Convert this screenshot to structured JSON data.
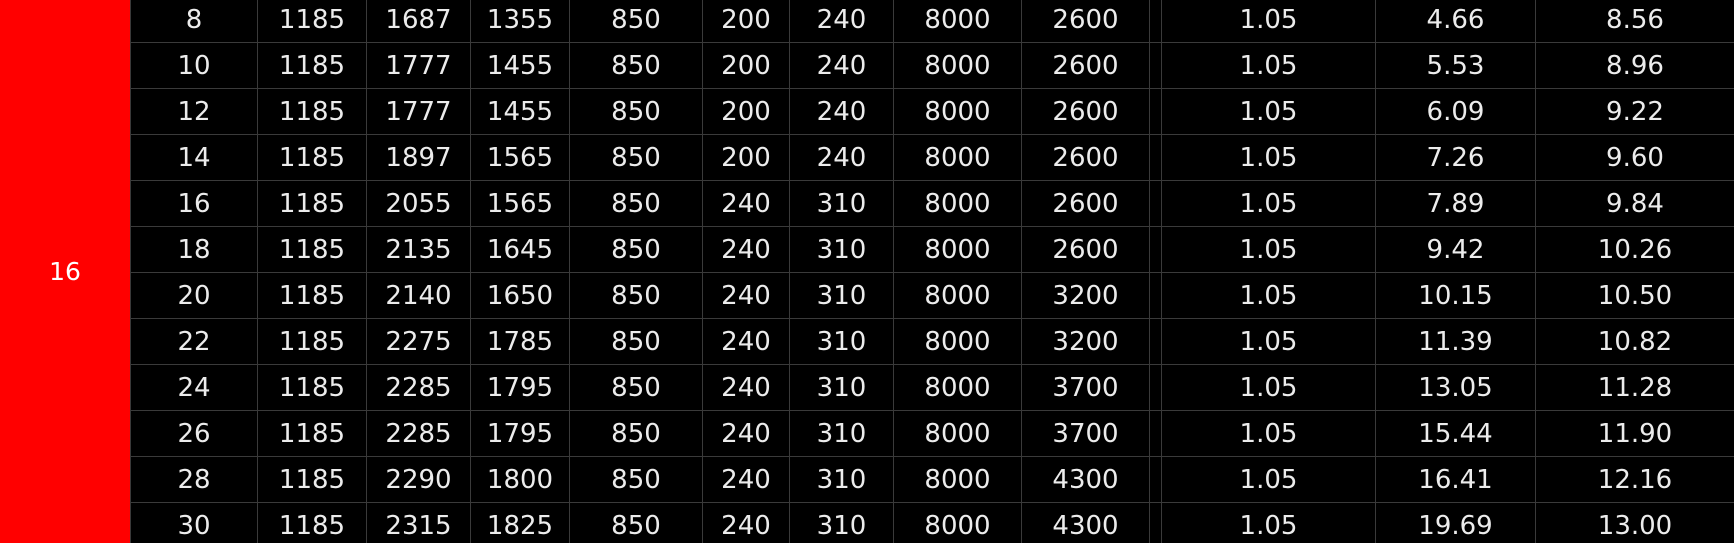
{
  "group": {
    "label": "16"
  },
  "rows": [
    [
      "8",
      "1185",
      "1687",
      "1355",
      "850",
      "200",
      "240",
      "8000",
      "2600",
      "1.05",
      "4.66",
      "8.56"
    ],
    [
      "10",
      "1185",
      "1777",
      "1455",
      "850",
      "200",
      "240",
      "8000",
      "2600",
      "1.05",
      "5.53",
      "8.96"
    ],
    [
      "12",
      "1185",
      "1777",
      "1455",
      "850",
      "200",
      "240",
      "8000",
      "2600",
      "1.05",
      "6.09",
      "9.22"
    ],
    [
      "14",
      "1185",
      "1897",
      "1565",
      "850",
      "200",
      "240",
      "8000",
      "2600",
      "1.05",
      "7.26",
      "9.60"
    ],
    [
      "16",
      "1185",
      "2055",
      "1565",
      "850",
      "240",
      "310",
      "8000",
      "2600",
      "1.05",
      "7.89",
      "9.84"
    ],
    [
      "18",
      "1185",
      "2135",
      "1645",
      "850",
      "240",
      "310",
      "8000",
      "2600",
      "1.05",
      "9.42",
      "10.26"
    ],
    [
      "20",
      "1185",
      "2140",
      "1650",
      "850",
      "240",
      "310",
      "8000",
      "3200",
      "1.05",
      "10.15",
      "10.50"
    ],
    [
      "22",
      "1185",
      "2275",
      "1785",
      "850",
      "240",
      "310",
      "8000",
      "3200",
      "1.05",
      "11.39",
      "10.82"
    ],
    [
      "24",
      "1185",
      "2285",
      "1795",
      "850",
      "240",
      "310",
      "8000",
      "3700",
      "1.05",
      "13.05",
      "11.28"
    ],
    [
      "26",
      "1185",
      "2285",
      "1795",
      "850",
      "240",
      "310",
      "8000",
      "3700",
      "1.05",
      "15.44",
      "11.90"
    ],
    [
      "28",
      "1185",
      "2290",
      "1800",
      "850",
      "240",
      "310",
      "8000",
      "4300",
      "1.05",
      "16.41",
      "12.16"
    ],
    [
      "30",
      "1185",
      "2315",
      "1825",
      "850",
      "240",
      "310",
      "8000",
      "4300",
      "1.05",
      "19.69",
      "13.00"
    ]
  ],
  "colors": {
    "group_bg": "#ff0000",
    "sheet_bg": "#000000",
    "text": "#ececec",
    "grid": "#3a3a3a"
  }
}
